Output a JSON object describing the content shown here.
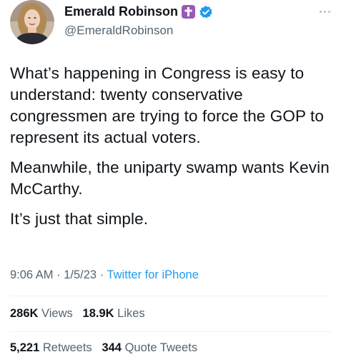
{
  "author": {
    "display_name": "Emerald Robinson",
    "handle": "@EmeraldRobinson",
    "badge_cross_color": "#9b59b6",
    "verified_color": "#1d9bf0"
  },
  "tweet": {
    "paragraphs": [
      "What’s happening in Congress is easy to understand: twenty conservative congressmen are trying to force the GOP to represent its actual voters.",
      "Meanwhile, the uniparty swamp wants Kevin McCarthy.",
      "It’s just that simple."
    ],
    "time": "9:06 AM",
    "date": "1/5/23",
    "separator": "·",
    "source": "Twitter for iPhone"
  },
  "stats": {
    "views_count": "286K",
    "views_label": "Views",
    "likes_count": "18.9K",
    "likes_label": "Likes",
    "retweets_count": "5,221",
    "retweets_label": "Retweets",
    "quotes_count": "344",
    "quotes_label": "Quote Tweets"
  },
  "icons": {
    "more": "more-horizontal-icon",
    "cross": "cross-badge-icon",
    "verified": "verified-badge-icon"
  }
}
